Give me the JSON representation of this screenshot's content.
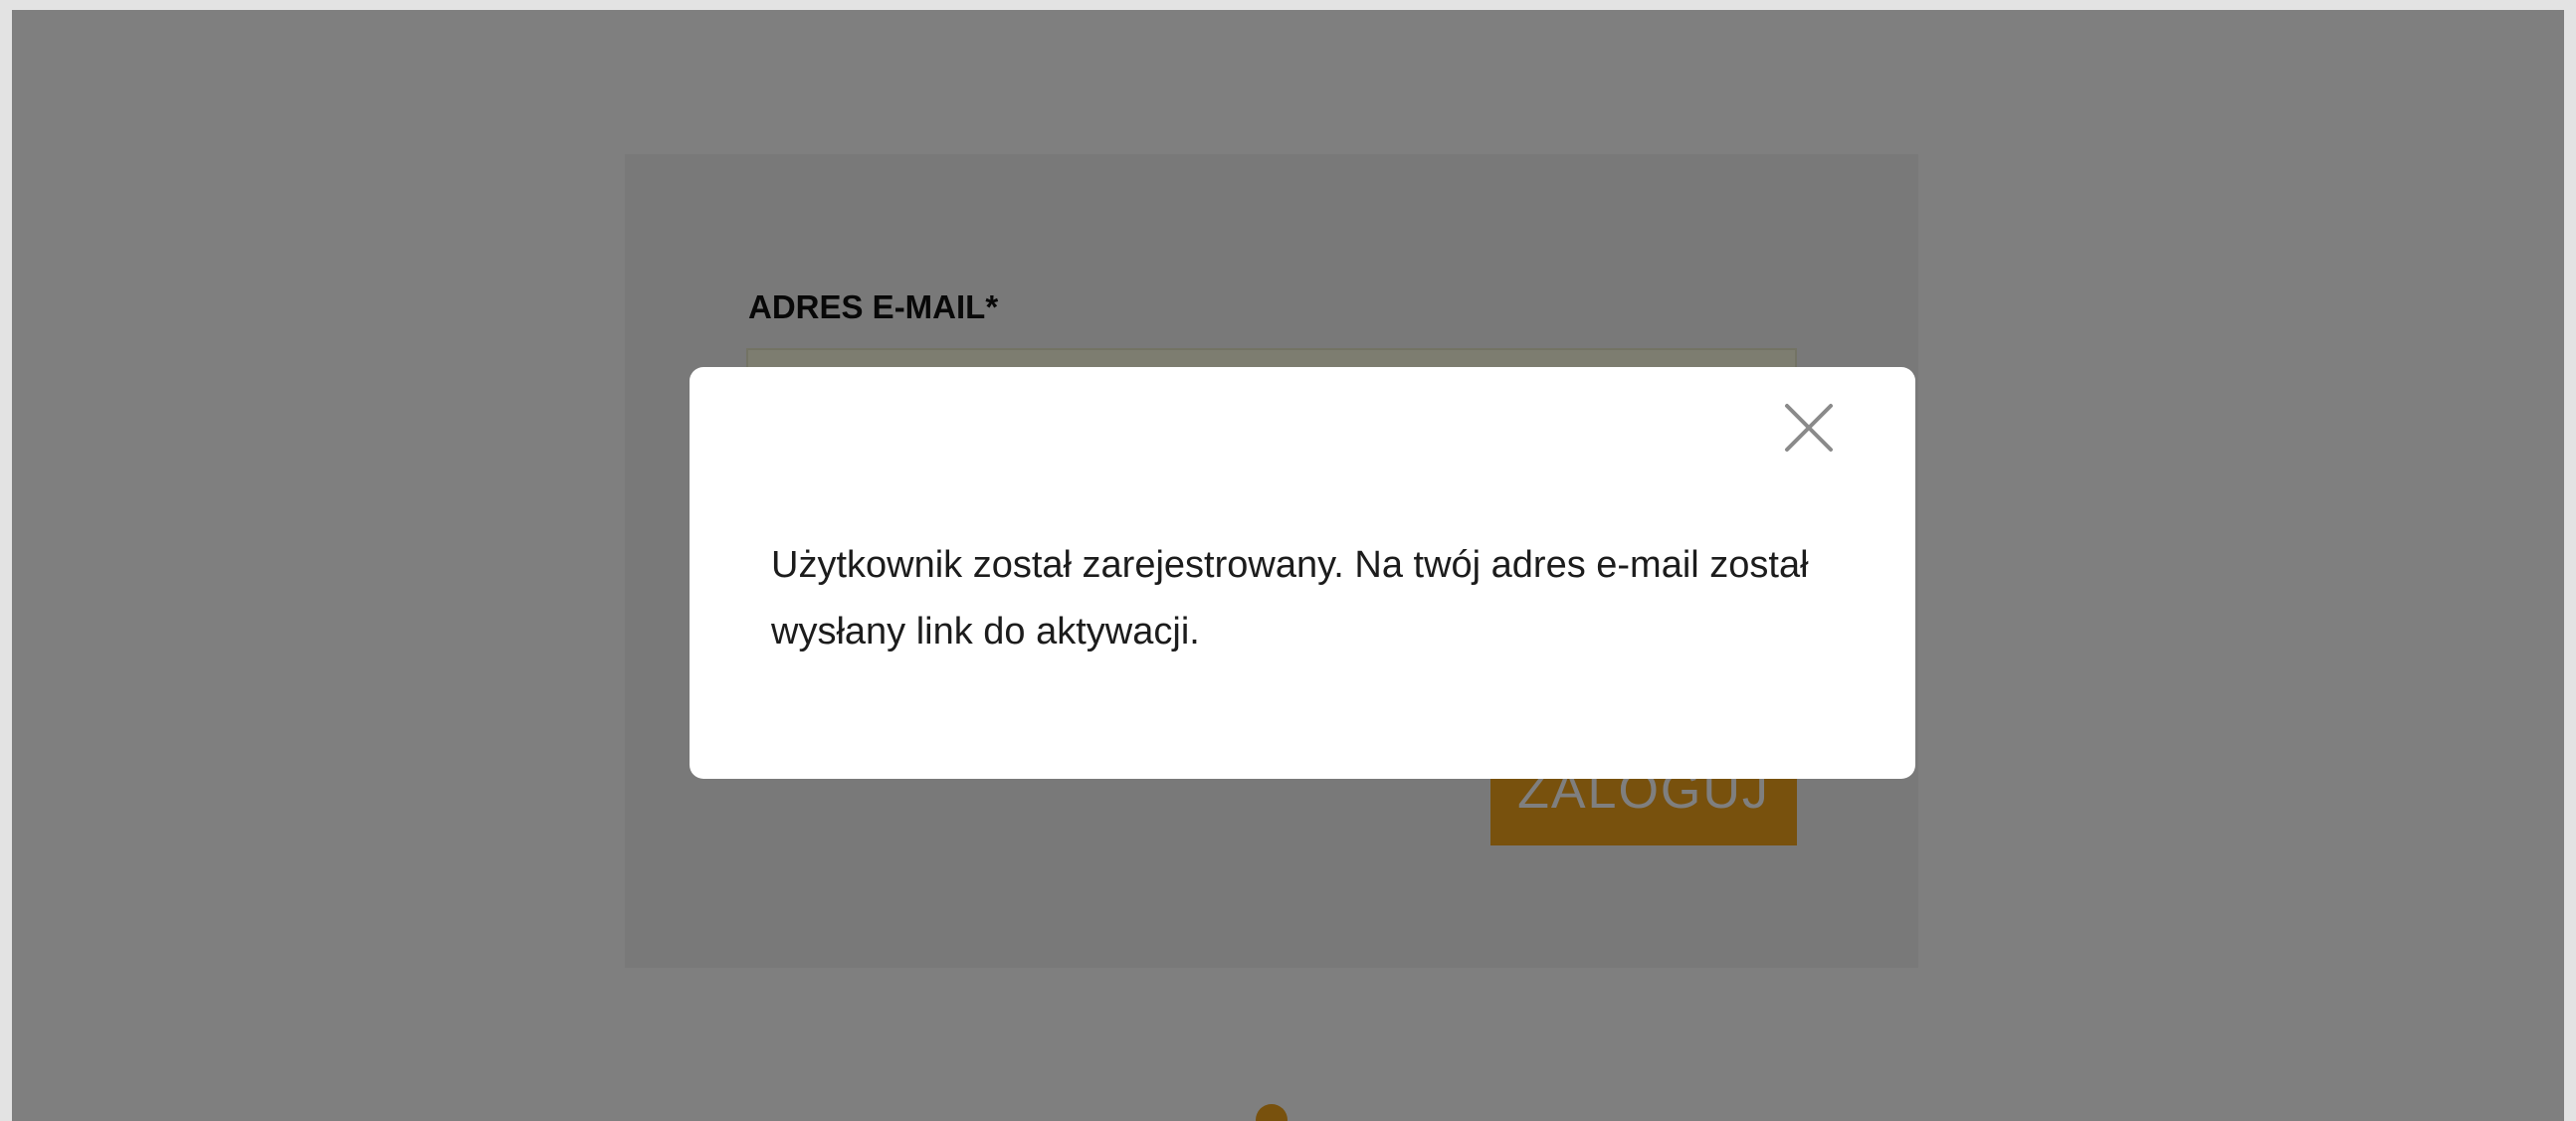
{
  "login_form": {
    "email_label": "ADRES E-MAIL*",
    "email_value": "",
    "login_button_label": "ZALOGUJ"
  },
  "modal": {
    "message": "Użytkownik został zarejestrowany. Na twój adres e-mail został wysłany link do aktywacji.",
    "close_icon": "close-icon"
  },
  "colors": {
    "accent": "#f0a21a",
    "overlay": "rgba(0,0,0,0.5)",
    "modal_background": "#ffffff"
  }
}
